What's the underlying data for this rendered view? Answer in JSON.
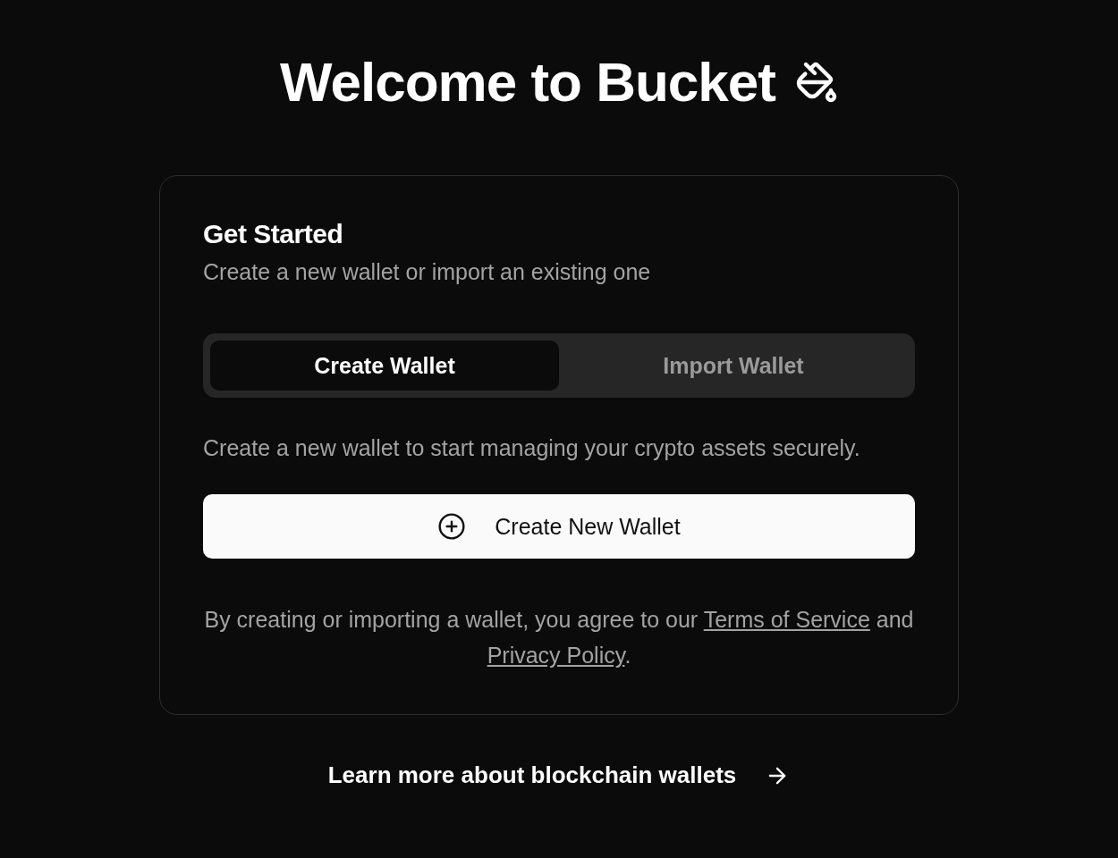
{
  "title": "Welcome to Bucket",
  "card": {
    "heading": "Get Started",
    "subtitle": "Create a new wallet or import an existing one",
    "tabs": [
      {
        "label": "Create Wallet",
        "selected": true
      },
      {
        "label": "Import Wallet",
        "selected": false
      }
    ],
    "description": "Create a new wallet to start managing your crypto assets securely.",
    "button": {
      "label": "Create New Wallet"
    },
    "legal": [
      {
        "kind": "text",
        "text": "By creating or importing a wallet, you agree to our "
      },
      {
        "kind": "link",
        "text": "Terms of Service"
      },
      {
        "kind": "text",
        "text": " and "
      },
      {
        "kind": "link",
        "text": "Privacy Policy"
      },
      {
        "kind": "text",
        "text": "."
      }
    ]
  },
  "footer_link": "Learn more about blockchain wallets"
}
